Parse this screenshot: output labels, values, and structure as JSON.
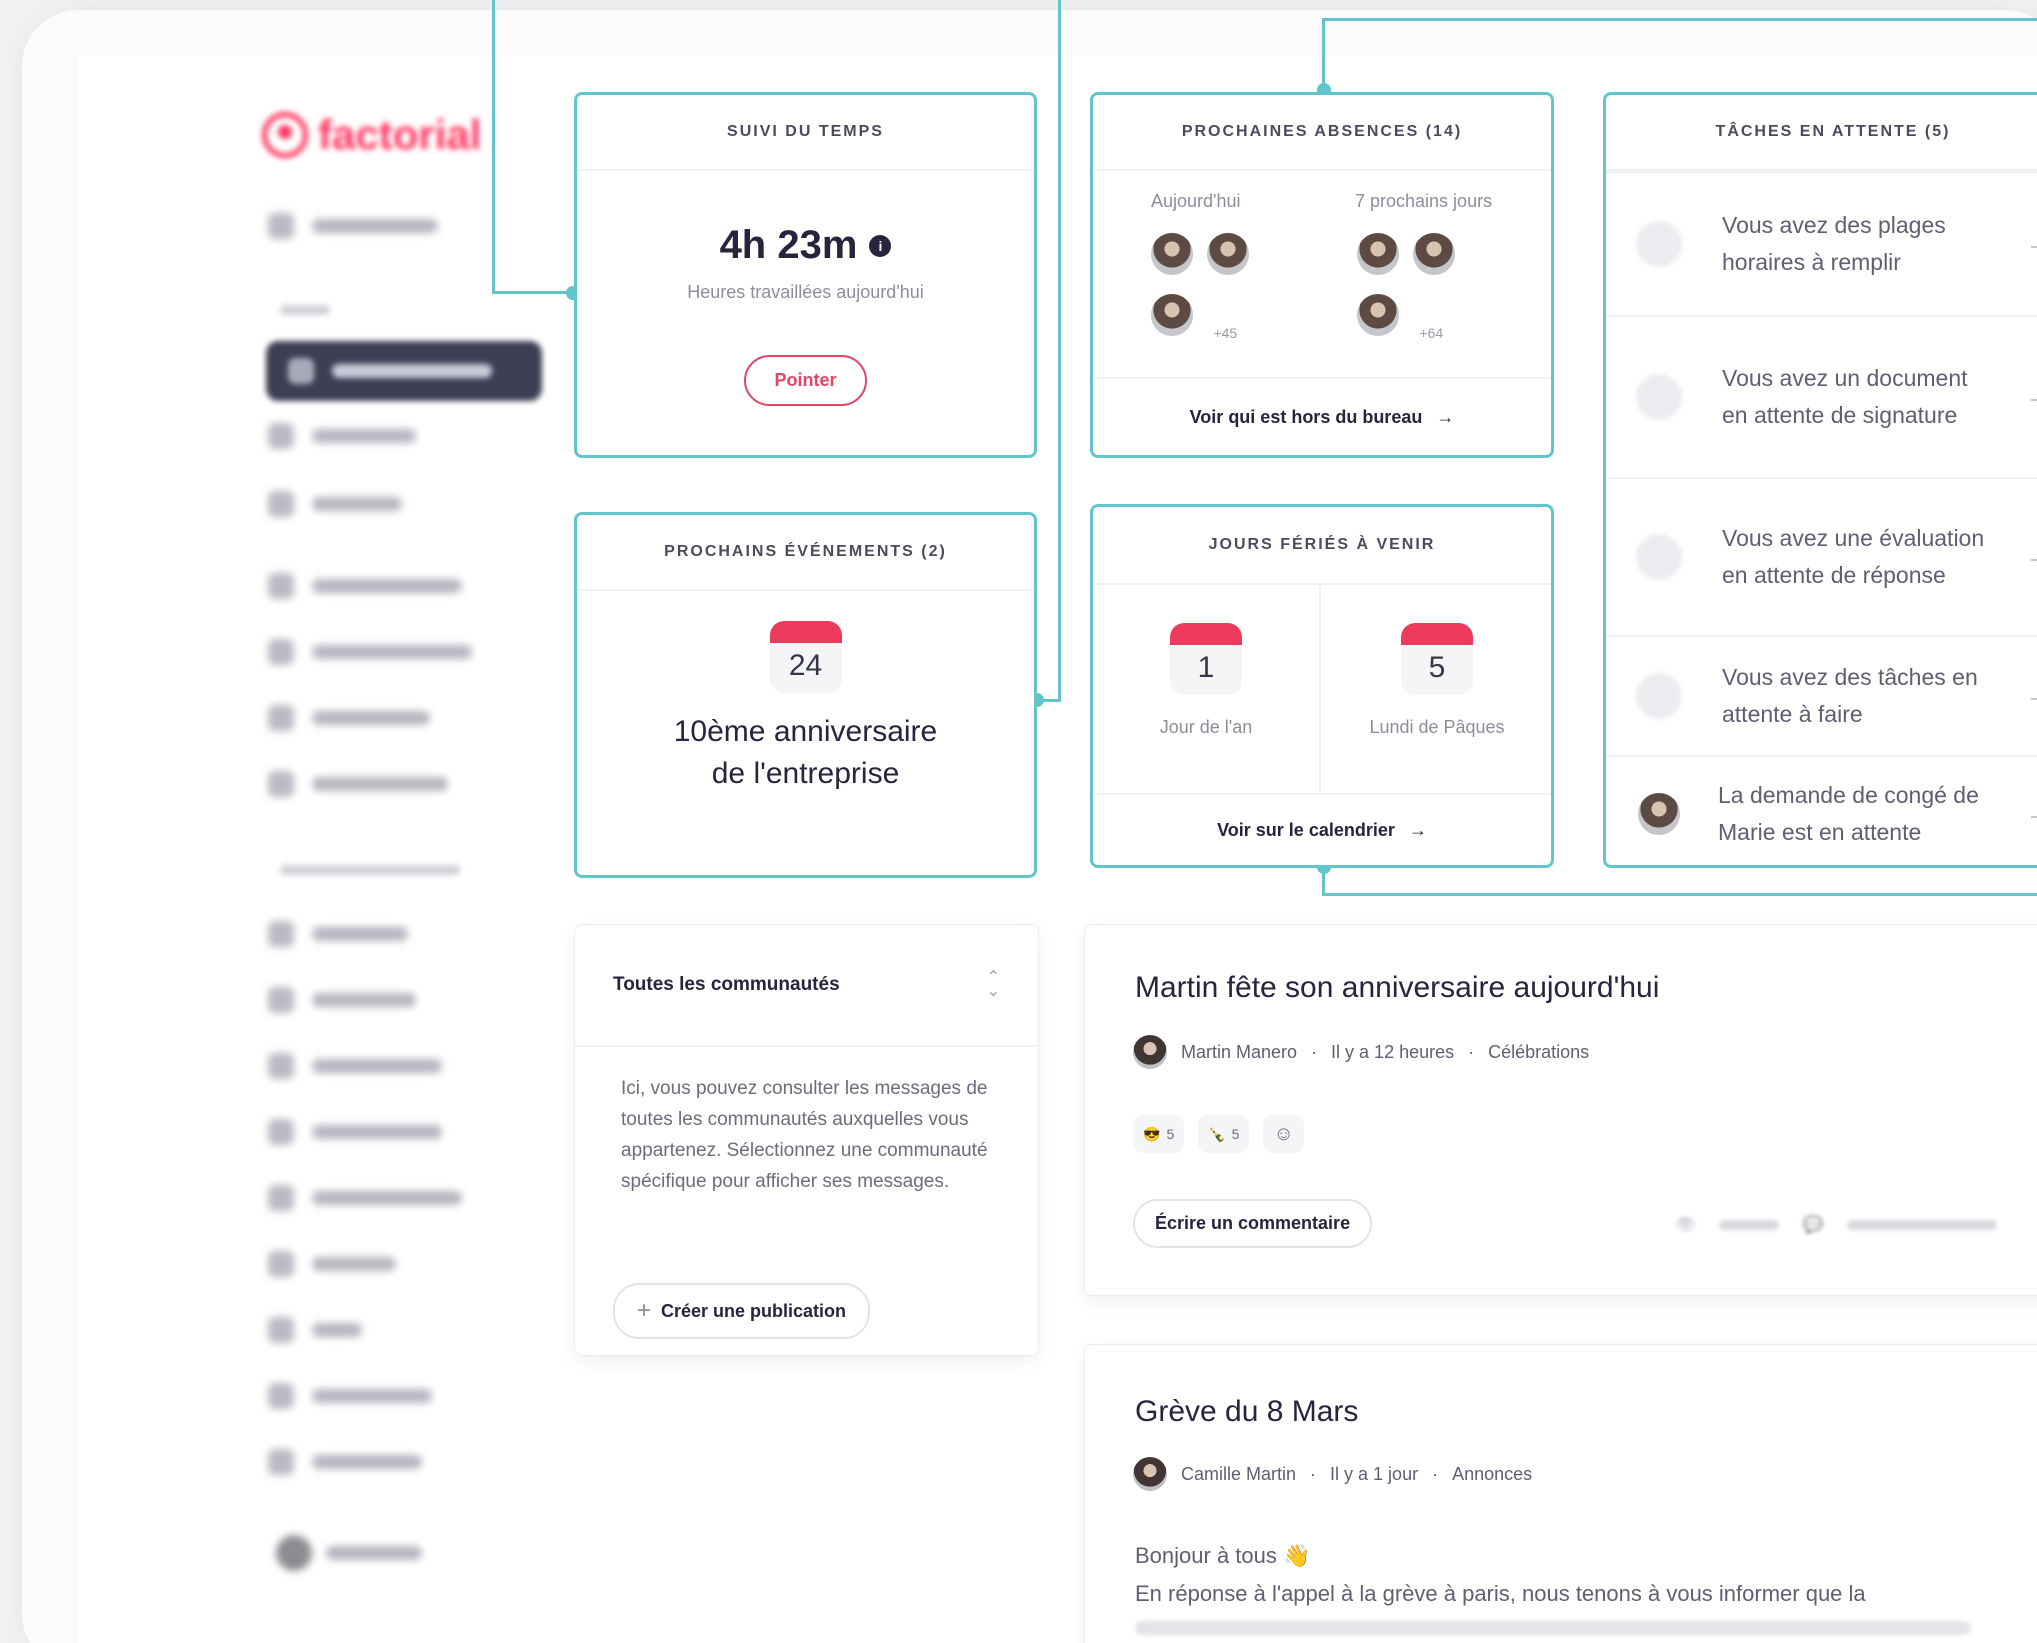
{
  "sidebar": {
    "logo": "factorial"
  },
  "time_tracking": {
    "title": "SUIVI DU TEMPS",
    "value": "4h 23m",
    "info_icon": "info-icon",
    "caption": "Heures travaillées aujourd'hui",
    "button": "Pointer"
  },
  "absences": {
    "title": "PROCHAINES ABSENCES (14)",
    "today_label": "Aujourd'hui",
    "next_label": "7 prochains jours",
    "today_more": "+45",
    "next_more": "+64",
    "link": "Voir qui est hors du bureau"
  },
  "tasks": {
    "title": "TÂCHES EN ATTENTE (5)",
    "items": [
      {
        "text": "Vous avez des plages horaires à remplir"
      },
      {
        "text": "Vous avez un document en attente de signature"
      },
      {
        "text": "Vous avez une évaluation en attente de réponse"
      },
      {
        "text": "Vous avez des tâches en attente à faire"
      },
      {
        "text": "La demande de congé de Marie est en attente"
      }
    ]
  },
  "events": {
    "title": "PROCHAINS ÉVÉNEMENTS (2)",
    "day": "24",
    "name_line1": "10ème anniversaire",
    "name_line2": "de l'entreprise"
  },
  "holidays": {
    "title": "JOURS FÉRIÉS À VENIR",
    "items": [
      {
        "day": "1",
        "name": "Jour de l'an"
      },
      {
        "day": "5",
        "name": "Lundi de Pâques"
      }
    ],
    "link": "Voir sur le calendrier"
  },
  "communities": {
    "selector": "Toutes les communautés",
    "description": "Ici, vous pouvez consulter les messages de toutes les communautés auxquelles vous appartenez. Sélectionnez une communauté spécifique pour afficher ses messages.",
    "create_button": "Créer une publication"
  },
  "posts": [
    {
      "title": "Martin fête son anniversaire aujourd'hui",
      "author": "Martin Manero",
      "time": "Il y a 12 heures",
      "channel": "Célébrations",
      "reactions": [
        {
          "emoji": "😎",
          "count": "5"
        },
        {
          "emoji": "🍾",
          "count": "5"
        }
      ],
      "comment_button": "Écrire un commentaire"
    },
    {
      "title": "Grève du 8 Mars",
      "author": "Camille Martin",
      "time": "Il y a 1 jour",
      "channel": "Annonces",
      "greeting": "Bonjour à tous 👋",
      "body": "En réponse à l'appel à la grève à paris, nous tenons à vous informer que la"
    }
  ],
  "colors": {
    "accent": "#63c5cc",
    "brand": "#ff355e",
    "calendar_red": "#ec3b5c"
  }
}
